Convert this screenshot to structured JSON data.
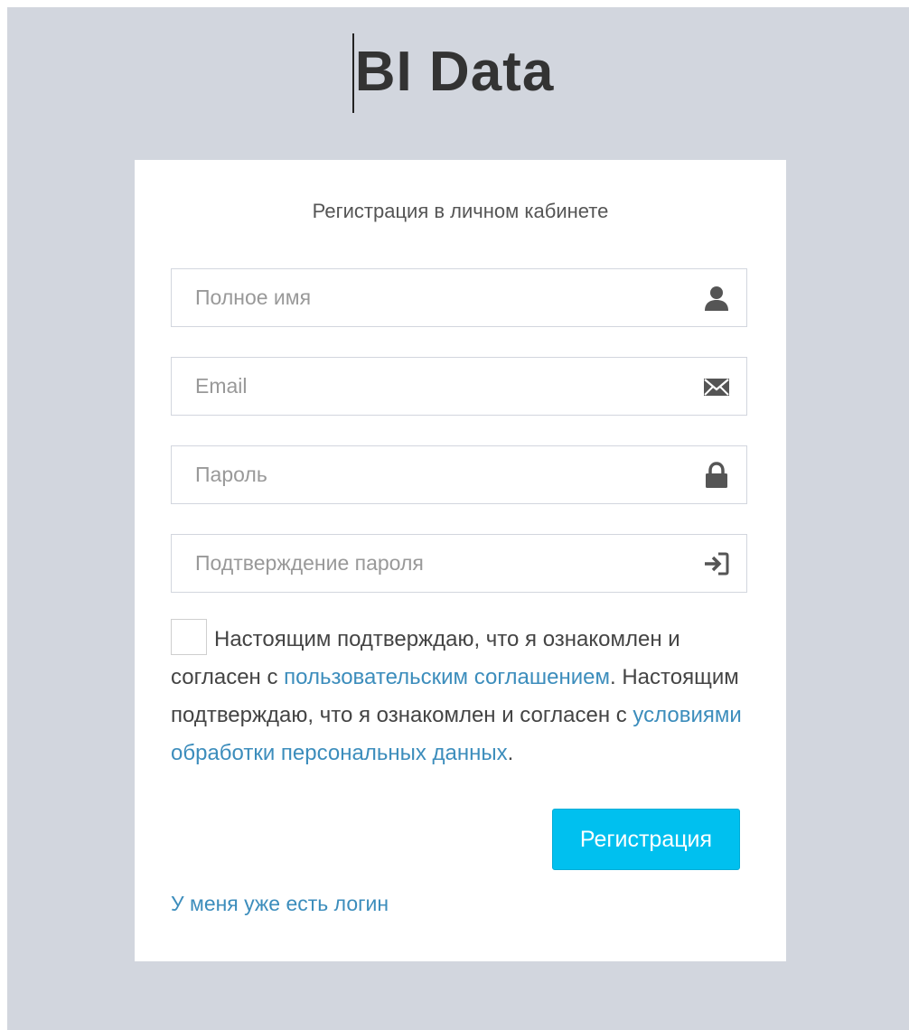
{
  "logo": {
    "text": "BI Data"
  },
  "form": {
    "title": "Регистрация в личном кабинете",
    "fields": [
      {
        "placeholder": "Полное имя",
        "value": "",
        "icon": "user-icon"
      },
      {
        "placeholder": "Email",
        "value": "",
        "icon": "envelope-icon"
      },
      {
        "placeholder": "Пароль",
        "value": "",
        "icon": "lock-icon"
      },
      {
        "placeholder": "Подтверждение пароля",
        "value": "",
        "icon": "log-in-icon"
      }
    ],
    "agreement": {
      "checked": false,
      "text_1": "Настоящим подтверждаю, что я ознакомлен и согласен с ",
      "link_1": "пользовательским соглашением",
      "text_2": ". Настоящим подтверждаю, что я ознакомлен и согласен с ",
      "link_2": "условиями обработки персональных данных",
      "text_3": "."
    },
    "submit_label": "Регистрация",
    "login_link": "У меня уже есть логин"
  },
  "colors": {
    "page_background": "#d2d6de",
    "card_background": "#ffffff",
    "button": "#00c0ef",
    "link": "#3c8dbc"
  }
}
